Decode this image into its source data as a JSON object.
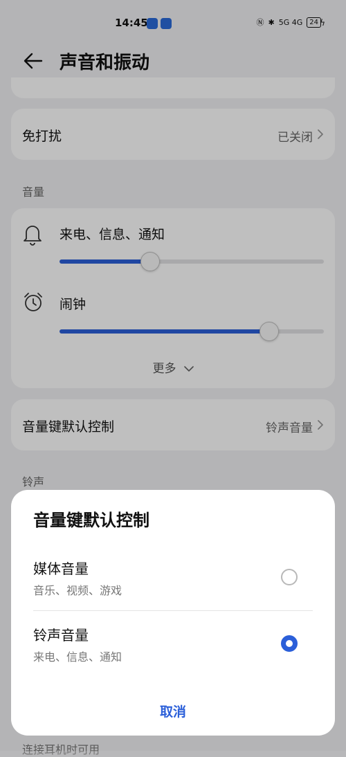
{
  "status_bar": {
    "time": "14:45",
    "signal": "5G  4G",
    "battery": "24"
  },
  "header": {
    "title": "声音和振动"
  },
  "dnd": {
    "label": "免打扰",
    "value": "已关闭"
  },
  "volume": {
    "section_title": "音量",
    "ringtone": {
      "label": "来电、信息、通知",
      "level": 0.34
    },
    "alarm": {
      "label": "闹钟",
      "level": 0.79
    },
    "more_label": "更多"
  },
  "volume_key": {
    "label": "音量键默认控制",
    "value": "铃声音量"
  },
  "ringtone_section": {
    "title": "铃声"
  },
  "sheet": {
    "title": "音量键默认控制",
    "options": [
      {
        "title": "媒体音量",
        "subtitle": "音乐、视频、游戏",
        "selected": false
      },
      {
        "title": "铃声音量",
        "subtitle": "来电、信息、通知",
        "selected": true
      }
    ],
    "cancel_label": "取消"
  },
  "footer": {
    "text": "连接耳机时可用"
  },
  "colors": {
    "accent": "#2b5fd9"
  }
}
